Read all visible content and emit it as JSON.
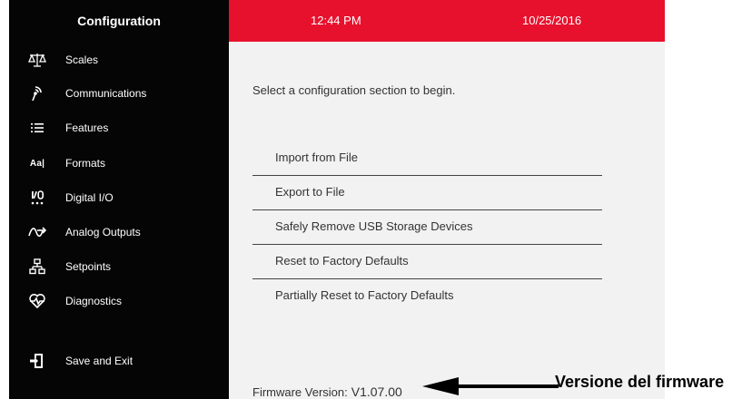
{
  "sidebar": {
    "title": "Configuration",
    "items": [
      {
        "label": "Scales",
        "icon": "scale-icon"
      },
      {
        "label": "Communications",
        "icon": "antenna-icon"
      },
      {
        "label": "Features",
        "icon": "list-icon"
      },
      {
        "label": "Formats",
        "icon": "text-format-icon",
        "glyph": "Aa|"
      },
      {
        "label": "Digital I/O",
        "icon": "io-icon"
      },
      {
        "label": "Analog Outputs",
        "icon": "analog-output-icon"
      },
      {
        "label": "Setpoints",
        "icon": "setpoints-icon"
      },
      {
        "label": "Diagnostics",
        "icon": "heart-pulse-icon"
      },
      {
        "label": "Save and Exit",
        "icon": "exit-icon"
      }
    ]
  },
  "header": {
    "time": "12:44 PM",
    "date": "10/25/2016",
    "accent_color": "#e8112d"
  },
  "main": {
    "prompt": "Select a configuration section to begin.",
    "menu": [
      "Import from File",
      "Export to File",
      "Safely Remove USB Storage Devices",
      "Reset to Factory Defaults",
      "Partially Reset to Factory Defaults"
    ],
    "firmware_label": "Firmware Version:",
    "firmware_value": "V1.07.00"
  },
  "annotation": {
    "text": "Versione del firmware"
  }
}
